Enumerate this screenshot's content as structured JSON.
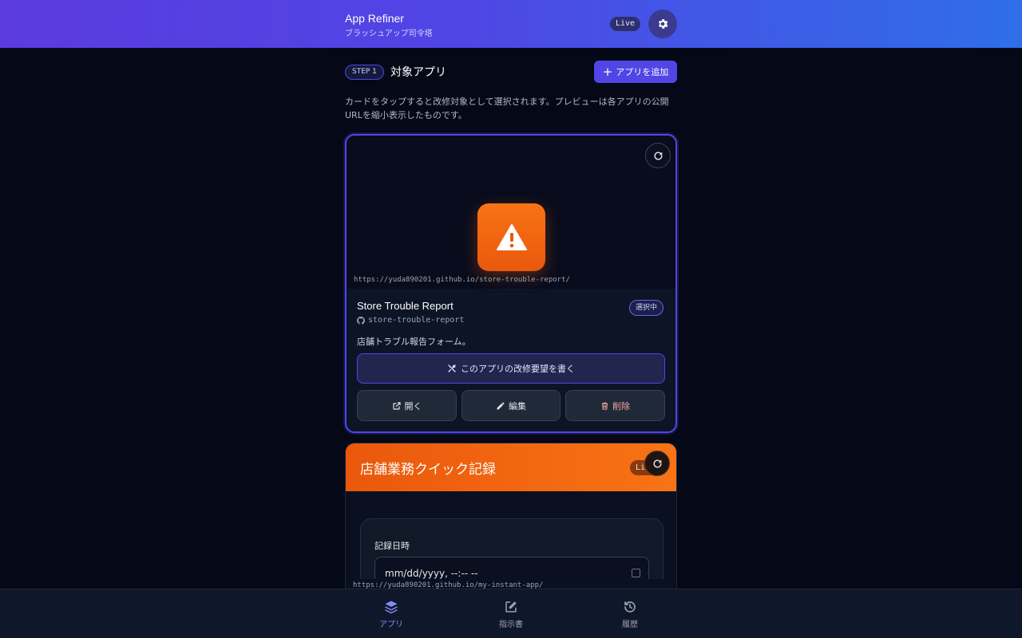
{
  "header": {
    "title": "App Refiner",
    "subtitle": "ブラッシュアップ司令塔",
    "live_badge": "Live",
    "settings_icon": "gear-icon"
  },
  "step": {
    "badge": "STEP 1",
    "title": "対象アプリ",
    "add_button": "アプリを追加",
    "description": "カードをタップすると改修対象として選択されます。プレビューは各アプリの公開URLを縮小表示したものです。"
  },
  "apps": [
    {
      "preview_url": "https://yuda890201.github.io/store-trouble-report/",
      "name": "Store Trouble Report",
      "repo": "store-trouble-report",
      "selected_badge": "選択中",
      "description": "店舗トラブル報告フォーム。",
      "request_button": "このアプリの改修要望を書く",
      "open_button": "開く",
      "edit_button": "編集",
      "delete_button": "削除",
      "icon": "warning-icon",
      "accent": "#f97316"
    },
    {
      "preview_url": "https://yuda890201.github.io/my-instant-app/",
      "preview_title": "店舗業務クイック記録",
      "preview_badge": "Li",
      "form_label": "記録日時",
      "date_placeholder": "mm/dd/yyyy, --:-- --"
    }
  ],
  "bottom_nav": [
    {
      "label": "アプリ",
      "icon": "layers-icon",
      "active": true
    },
    {
      "label": "指示書",
      "icon": "edit-icon",
      "active": false
    },
    {
      "label": "履歴",
      "icon": "history-icon",
      "active": false
    }
  ],
  "colors": {
    "accent": "#4f46e5",
    "background": "#050816",
    "card_accent": "#f97316"
  }
}
